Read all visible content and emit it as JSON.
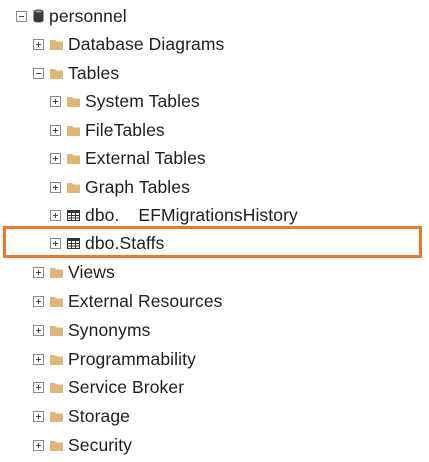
{
  "tree": {
    "root": {
      "label": "personnel",
      "icon": "database-icon",
      "expanded": true
    },
    "db_children": [
      {
        "key": "database-diagrams",
        "label": "Database Diagrams",
        "icon": "folder-icon",
        "expanded": false
      },
      {
        "key": "tables",
        "label": "Tables",
        "icon": "folder-icon",
        "expanded": true
      },
      {
        "key": "views",
        "label": "Views",
        "icon": "folder-icon",
        "expanded": false
      },
      {
        "key": "external-resources",
        "label": "External Resources",
        "icon": "folder-icon",
        "expanded": false
      },
      {
        "key": "synonyms",
        "label": "Synonyms",
        "icon": "folder-icon",
        "expanded": false
      },
      {
        "key": "programmability",
        "label": "Programmability",
        "icon": "folder-icon",
        "expanded": false
      },
      {
        "key": "service-broker",
        "label": "Service Broker",
        "icon": "folder-icon",
        "expanded": false
      },
      {
        "key": "storage",
        "label": "Storage",
        "icon": "folder-icon",
        "expanded": false
      },
      {
        "key": "security",
        "label": "Security",
        "icon": "folder-icon",
        "expanded": false
      }
    ],
    "tables_children": [
      {
        "key": "system-tables",
        "label": "System Tables",
        "icon": "folder-icon",
        "expanded": false
      },
      {
        "key": "filetables",
        "label": "FileTables",
        "icon": "folder-icon",
        "expanded": false
      },
      {
        "key": "external-tables",
        "label": "External Tables",
        "icon": "folder-icon",
        "expanded": false
      },
      {
        "key": "graph-tables",
        "label": "Graph Tables",
        "icon": "folder-icon",
        "expanded": false
      },
      {
        "key": "ef-migrations-history",
        "label": "dbo. EFMigrationsHistory",
        "icon": "table-icon",
        "expanded": false
      },
      {
        "key": "dbo-staffs",
        "label": "dbo.Staffs",
        "icon": "table-icon",
        "expanded": false,
        "highlighted": true
      }
    ]
  },
  "colors": {
    "highlight_border": "#e87b2b",
    "folder": "#dcb67a",
    "text": "#1e1e1e"
  }
}
